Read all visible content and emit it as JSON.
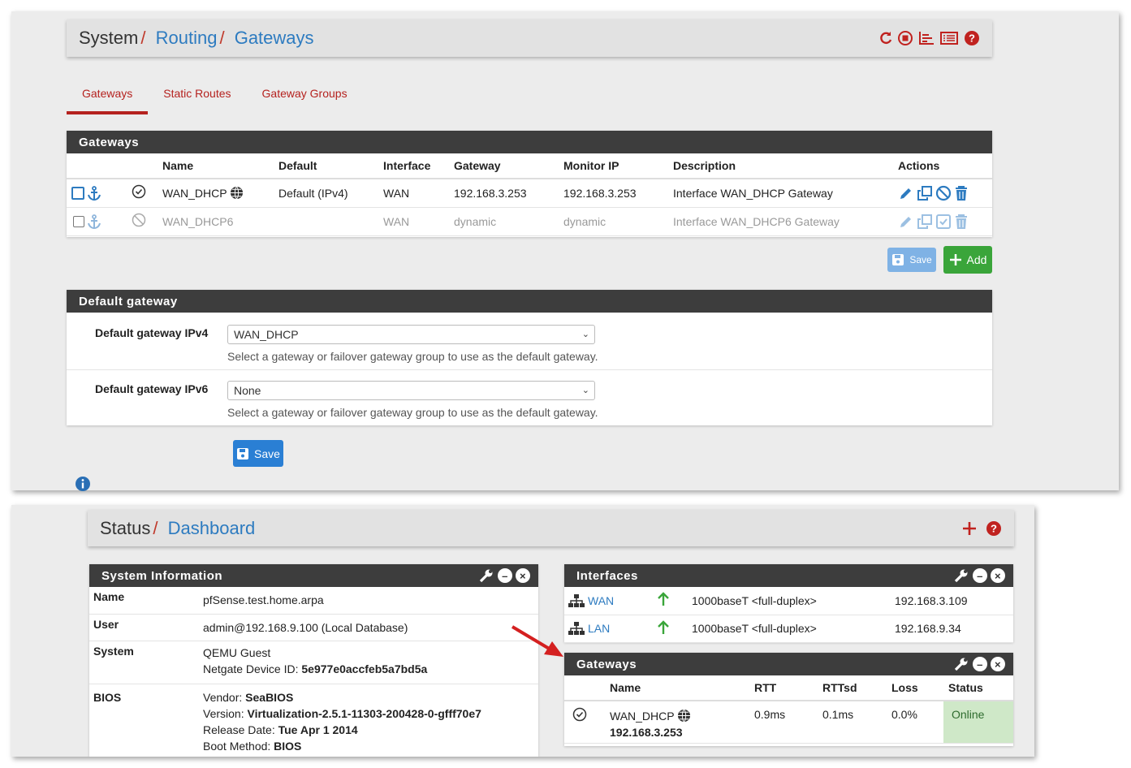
{
  "routing": {
    "crumbs": [
      "System",
      "Routing",
      "Gateways"
    ],
    "tabs": [
      "Gateways",
      "Static Routes",
      "Gateway Groups"
    ],
    "gateways_panel": {
      "title": "Gateways",
      "headers": [
        "Name",
        "Default",
        "Interface",
        "Gateway",
        "Monitor IP",
        "Description",
        "Actions"
      ],
      "rows": [
        {
          "name": "WAN_DHCP",
          "default": "Default (IPv4)",
          "interface": "WAN",
          "gateway": "192.168.3.253",
          "monitor": "192.168.3.253",
          "description": "Interface WAN_DHCP Gateway"
        },
        {
          "name": "WAN_DHCP6",
          "default": "",
          "interface": "WAN",
          "gateway": "dynamic",
          "monitor": "dynamic",
          "description": "Interface WAN_DHCP6 Gateway"
        }
      ],
      "save_label": "Save",
      "add_label": "Add"
    },
    "default_panel": {
      "title": "Default gateway",
      "ipv4_label": "Default gateway IPv4",
      "ipv4_value": "WAN_DHCP",
      "ipv6_label": "Default gateway IPv6",
      "ipv6_value": "None",
      "help": "Select a gateway or failover gateway group to use as the default gateway.",
      "save_label": "Save"
    }
  },
  "dashboard": {
    "crumbs": [
      "Status",
      "Dashboard"
    ],
    "sysinfo": {
      "title": "System Information",
      "name_label": "Name",
      "name": "pfSense.test.home.arpa",
      "user_label": "User",
      "user": "admin@192.168.9.100 (Local Database)",
      "system_label": "System",
      "system": "QEMU Guest",
      "device_id_label": "Netgate Device ID:",
      "device_id": "5e977e0accfeb5a7bd5a",
      "bios_label": "BIOS",
      "vendor_label": "Vendor:",
      "vendor": "SeaBIOS",
      "version_label": "Version:",
      "version": "Virtualization-2.5.1-11303-200428-0-gfff70e7",
      "release_label": "Release Date:",
      "release": "Tue Apr 1 2014",
      "boot_label": "Boot Method:",
      "boot": "BIOS"
    },
    "interfaces": {
      "title": "Interfaces",
      "rows": [
        {
          "name": "WAN",
          "media": "1000baseT <full-duplex>",
          "ip": "192.168.3.109"
        },
        {
          "name": "LAN",
          "media": "1000baseT <full-duplex>",
          "ip": "192.168.9.34"
        }
      ]
    },
    "gw_widget": {
      "title": "Gateways",
      "headers": [
        "Name",
        "RTT",
        "RTTsd",
        "Loss",
        "Status"
      ],
      "row": {
        "name": "WAN_DHCP",
        "ip": "192.168.3.253",
        "rtt": "0.9ms",
        "rttsd": "0.1ms",
        "loss": "0.0%",
        "status": "Online"
      }
    }
  },
  "colors": {
    "accent": "#b5221f",
    "link": "#2d7bc0",
    "online": "#cfe8c8",
    "save_btn": "#2a7fd4",
    "add_btn": "#3aa53a",
    "panel_header": "#3d3d3d"
  }
}
